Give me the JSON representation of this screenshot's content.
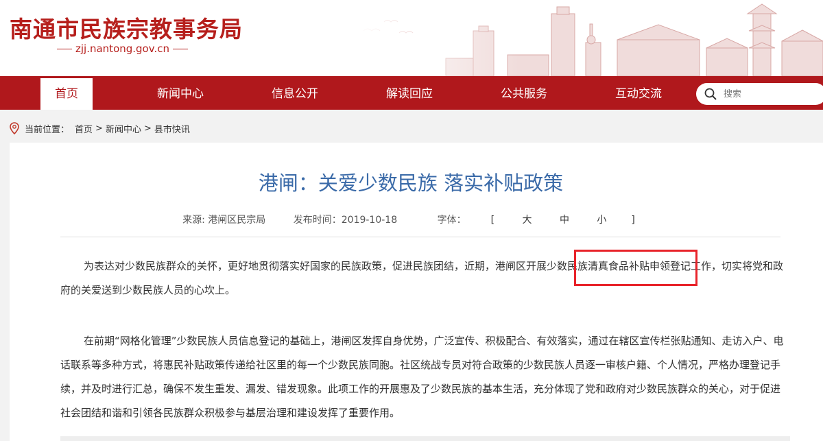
{
  "header": {
    "site_title": "南通市民族宗教事务局",
    "site_domain": "zjj.nantong.gov.cn"
  },
  "nav": {
    "items": [
      {
        "label": "首页",
        "active": true
      },
      {
        "label": "新闻中心"
      },
      {
        "label": "信息公开"
      },
      {
        "label": "解读回应"
      },
      {
        "label": "公共服务"
      },
      {
        "label": "互动交流"
      }
    ],
    "search_placeholder": "搜索"
  },
  "breadcrumb": {
    "prefix": "当前位置：",
    "items": [
      "首页",
      "新闻中心",
      "县市快讯"
    ],
    "separator": ">"
  },
  "article": {
    "title": "港闸：关爱少数民族 落实补贴政策",
    "source": "来源: 港闸区民宗局",
    "publish_time": "发布时间：2019-10-18",
    "font_label": "字体：",
    "font_sizes": [
      "大",
      "中",
      "小"
    ],
    "paragraphs": [
      "为表达对少数民族群众的关怀，更好地贯彻落实好国家的民族政策，促进民族团结，近期，港闸区开展少数民族清真食品补贴申领登记工作，切实将党和政府的关爱送到少数民族人员的心坎上。",
      "在前期“网格化管理”少数民族人员信息登记的基础上，港闸区发挥自身优势，广泛宣传、积极配合、有效落实，通过在辖区宣传栏张贴通知、走访入户、电话联系等多种方式，将惠民补贴政策传递给社区里的每一个少数民族同胞。社区统战专员对符合政策的少数民族人员逐一审核户籍、个人情况，严格办理登记手续，并及时进行汇总，确保不发生重发、漏发、错发现象。此项工作的开展惠及了少数民族的基本生活，充分体现了党和政府对少数民族群众的关心，对于促进社会团结和谐和引领各民族群众积极参与基层治理和建设发挥了重要作用。"
    ]
  },
  "colors": {
    "brand_red": "#b0181c",
    "title_blue": "#3a6aa8",
    "highlight_red": "#e8232a"
  }
}
